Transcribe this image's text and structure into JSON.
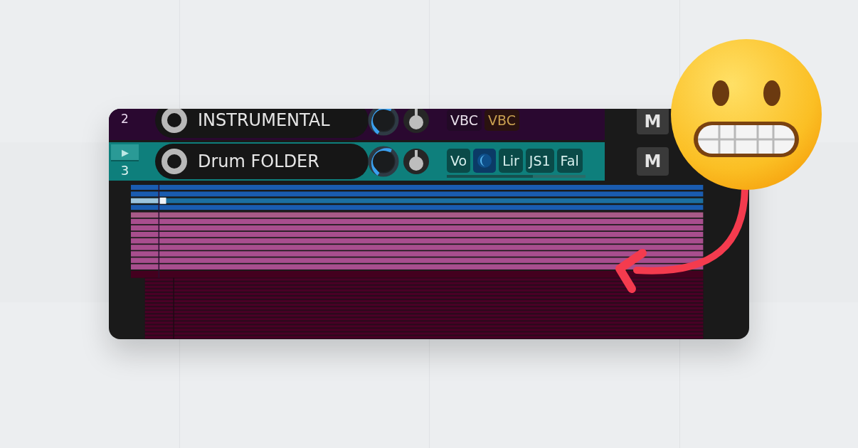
{
  "tracks": [
    {
      "number": "2",
      "name": "INSTRUMENTAL",
      "color": "#2a0830",
      "fx": [
        {
          "kind": "text",
          "label": "VBC",
          "bypassed": false
        },
        {
          "kind": "text",
          "label": "VBC",
          "bypassed": true
        }
      ],
      "buttons": [
        {
          "label": "M"
        }
      ]
    },
    {
      "number": "3",
      "folder_button": "▶",
      "name": "Drum FOLDER",
      "color": "#0e7f7c",
      "fx": [
        {
          "kind": "text",
          "label": "Vo",
          "bypassed": false
        },
        {
          "kind": "knob",
          "bypassed": false
        },
        {
          "kind": "text",
          "label": "Lir",
          "bypassed": false
        },
        {
          "kind": "text",
          "label": "JS1",
          "bypassed": false
        },
        {
          "kind": "text",
          "label": "Fal",
          "bypassed": false
        }
      ],
      "fx_meter": {
        "level": 0.62
      },
      "buttons": [
        {
          "label": "M"
        }
      ]
    }
  ]
}
